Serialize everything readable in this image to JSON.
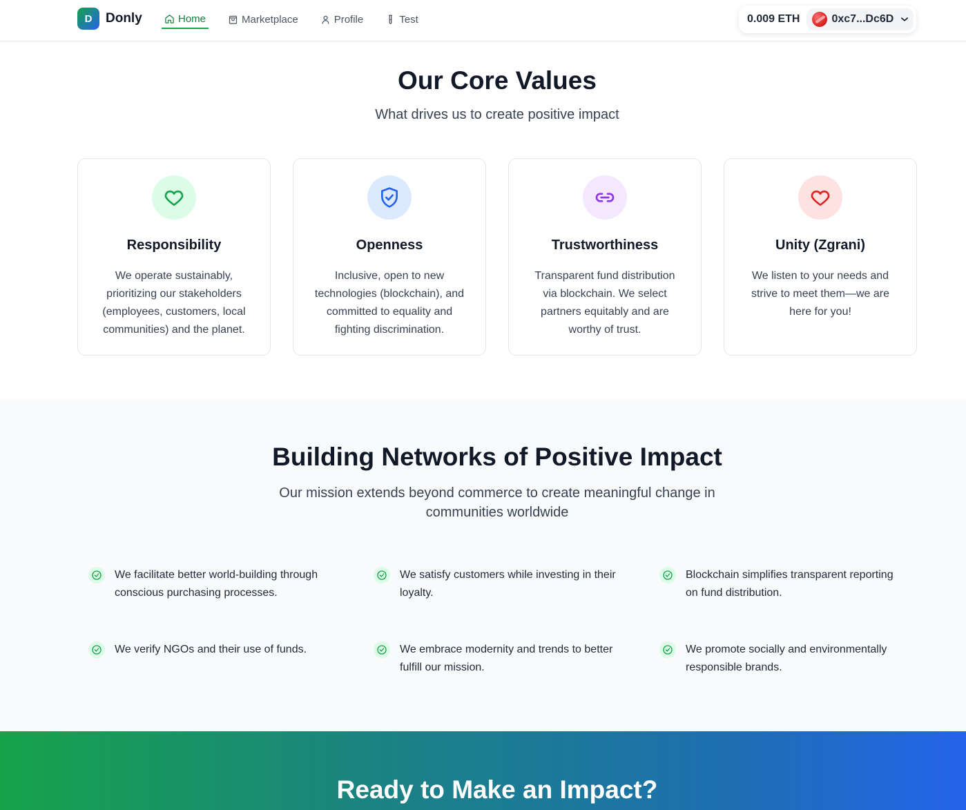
{
  "header": {
    "logo_letter": "D",
    "brand": "Donly",
    "nav": [
      {
        "label": "Home",
        "icon": "home-icon",
        "active": true
      },
      {
        "label": "Marketplace",
        "icon": "bag-icon",
        "active": false
      },
      {
        "label": "Profile",
        "icon": "user-icon",
        "active": false
      },
      {
        "label": "Test",
        "icon": "test-tube-icon",
        "active": false
      }
    ],
    "wallet": {
      "balance": "0.009 ETH",
      "address": "0xc7...Dc6D"
    }
  },
  "values": {
    "title": "Our Core Values",
    "subtitle": "What drives us to create positive impact",
    "cards": [
      {
        "title": "Responsibility",
        "text": "We operate sustainably, prioritizing our stakeholders (employees, customers, local communities) and the planet.",
        "icon": "heart-outline-icon",
        "color": "#16a34a",
        "bg": "#dcfce7"
      },
      {
        "title": "Openness",
        "text": "Inclusive, open to new technologies (blockchain), and committed to equality and fighting discrimination.",
        "icon": "shield-check-icon",
        "color": "#2563eb",
        "bg": "#dbeafe"
      },
      {
        "title": "Trustworthiness",
        "text": "Transparent fund distribution via blockchain. We select partners equitably and are worthy of trust.",
        "icon": "link-icon",
        "color": "#9333ea",
        "bg": "#f3e8ff"
      },
      {
        "title": "Unity (Zgrani)",
        "text": "We listen to your needs and strive to meet them—we are here for you!",
        "icon": "heart-icon",
        "color": "#dc2626",
        "bg": "#fee2e2"
      }
    ]
  },
  "mission": {
    "title": "Building Networks of Positive Impact",
    "subtitle": "Our mission extends beyond commerce to create meaningful change in communities worldwide",
    "points": [
      "We facilitate better world-building through conscious purchasing processes.",
      "We satisfy customers while investing in their loyalty.",
      "Blockchain simplifies transparent reporting on fund distribution.",
      "We verify NGOs and their use of funds.",
      "We embrace modernity and trends to better fulfill our mission.",
      "We promote socially and environmentally responsible brands."
    ]
  },
  "cta": {
    "title": "Ready to Make an Impact?"
  }
}
